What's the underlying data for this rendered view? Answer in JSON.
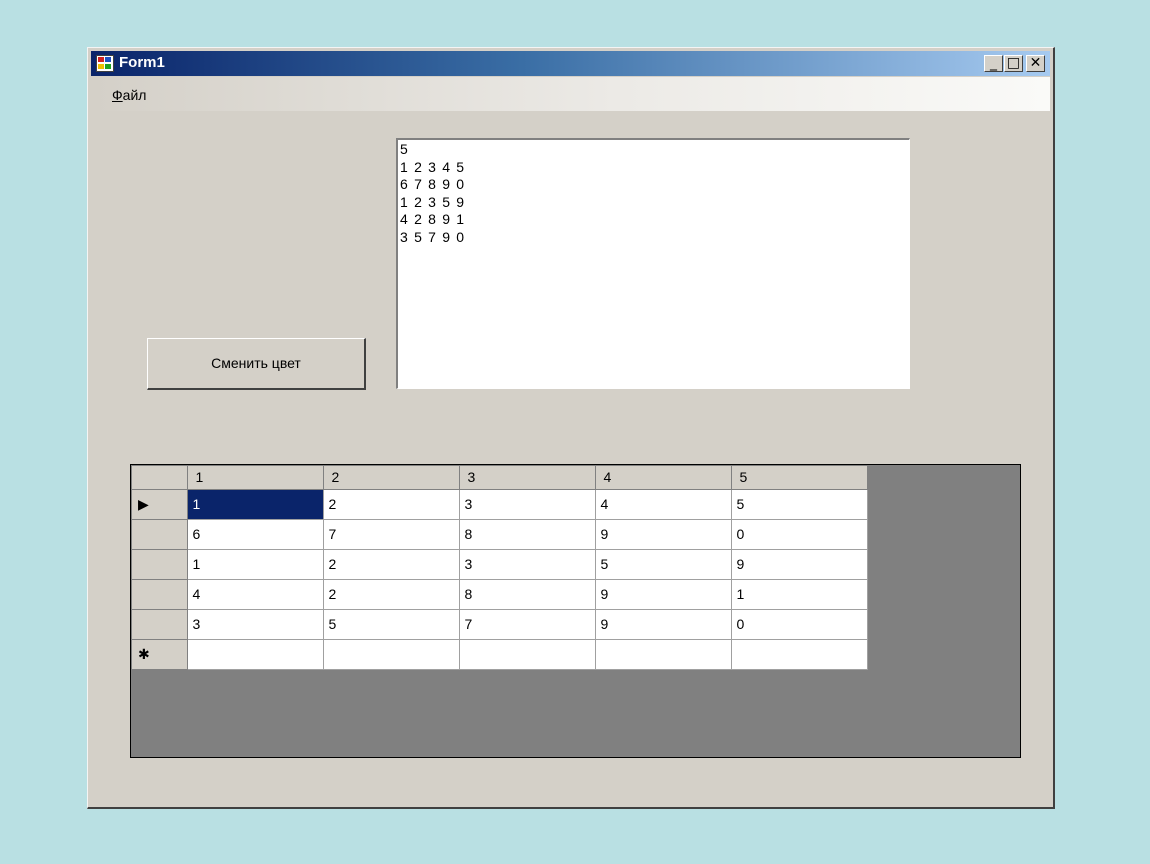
{
  "window": {
    "title": "Form1"
  },
  "title_buttons": {
    "minimize": "_",
    "maximize": "□",
    "close": "✕"
  },
  "menu": {
    "file_accel": "Ф",
    "file_rest": "айл"
  },
  "button": {
    "label": "Сменить цвет"
  },
  "textbox": {
    "lines": [
      "5",
      "1 2 3 4 5",
      "6 7 8 9 0",
      "1 2 3 5 9",
      "4 2 8 9 1",
      "3 5 7 9 0"
    ]
  },
  "grid": {
    "columns": [
      "1",
      "2",
      "3",
      "4",
      "5"
    ],
    "rows": [
      [
        "1",
        "2",
        "3",
        "4",
        "5"
      ],
      [
        "6",
        "7",
        "8",
        "9",
        "0"
      ],
      [
        "1",
        "2",
        "3",
        "5",
        "9"
      ],
      [
        "4",
        "2",
        "8",
        "9",
        "1"
      ],
      [
        "3",
        "5",
        "7",
        "9",
        "0"
      ]
    ],
    "current_row_marker": "▶",
    "new_row_marker": "✱",
    "selected_cell": {
      "row": 1,
      "col": 1
    }
  },
  "colors": {
    "desktop": "#b9e0e3",
    "form": "#d4d0c8",
    "titlebar_start": "#0a246a",
    "titlebar_end": "#a6caf0",
    "selection": "#0a246a",
    "grid_background": "#808080"
  }
}
